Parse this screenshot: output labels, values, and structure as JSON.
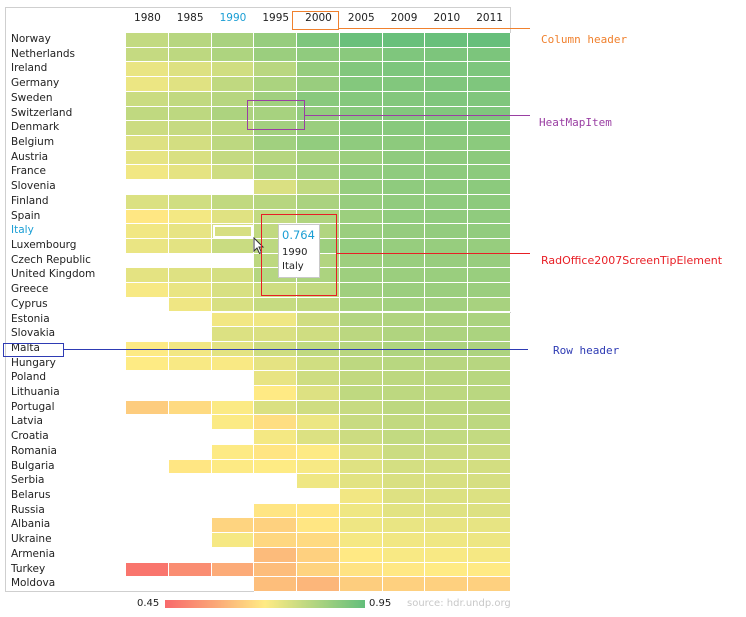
{
  "chart_data": {
    "type": "heatmap",
    "title": "",
    "columns": [
      "1980",
      "1985",
      "1990",
      "1995",
      "2000",
      "2005",
      "2009",
      "2010",
      "2011"
    ],
    "rows": [
      "Norway",
      "Netherlands",
      "Ireland",
      "Germany",
      "Sweden",
      "Switzerland",
      "Denmark",
      "Belgium",
      "Austria",
      "France",
      "Slovenia",
      "Finland",
      "Spain",
      "Italy",
      "Luxembourg",
      "Czech Republic",
      "United Kingdom",
      "Greece",
      "Cyprus",
      "Estonia",
      "Slovakia",
      "Malta",
      "Hungary",
      "Poland",
      "Lithuania",
      "Portugal",
      "Latvia",
      "Croatia",
      "Romania",
      "Bulgaria",
      "Serbia",
      "Belarus",
      "Russia",
      "Albania",
      "Ukraine",
      "Armenia",
      "Turkey",
      "Moldova"
    ],
    "values": [
      [
        0.796,
        0.816,
        0.838,
        0.866,
        0.906,
        0.938,
        0.941,
        0.941,
        0.943
      ],
      [
        0.793,
        0.806,
        0.83,
        0.861,
        0.878,
        0.888,
        0.905,
        0.909,
        0.91
      ],
      [
        0.735,
        0.754,
        0.775,
        0.812,
        0.869,
        0.901,
        0.908,
        0.908,
        0.908
      ],
      [
        0.73,
        0.749,
        0.801,
        0.834,
        0.864,
        0.897,
        0.9,
        0.903,
        0.905
      ],
      [
        0.785,
        0.799,
        0.816,
        0.851,
        0.889,
        0.895,
        0.898,
        0.904,
        0.904
      ],
      [
        0.801,
        0.806,
        0.831,
        0.841,
        0.873,
        0.893,
        0.899,
        0.901,
        0.903
      ],
      [
        0.781,
        0.792,
        0.806,
        0.848,
        0.862,
        0.888,
        0.891,
        0.895,
        0.895
      ],
      [
        0.753,
        0.771,
        0.805,
        0.851,
        0.874,
        0.88,
        0.883,
        0.884,
        0.886
      ],
      [
        0.74,
        0.761,
        0.794,
        0.817,
        0.839,
        0.858,
        0.879,
        0.881,
        0.885
      ],
      [
        0.722,
        0.742,
        0.779,
        0.825,
        0.846,
        0.872,
        0.879,
        0.882,
        0.884
      ],
      [
        null,
        null,
        null,
        0.76,
        0.801,
        0.868,
        0.879,
        0.88,
        0.884
      ],
      [
        0.757,
        0.775,
        0.799,
        0.816,
        0.837,
        0.866,
        0.876,
        0.879,
        0.882
      ],
      [
        0.693,
        0.719,
        0.749,
        0.796,
        0.826,
        0.858,
        0.874,
        0.876,
        0.878
      ],
      [
        0.723,
        0.739,
        0.764,
        0.799,
        0.825,
        0.861,
        0.87,
        0.873,
        0.874
      ],
      [
        0.733,
        0.745,
        0.786,
        0.808,
        0.857,
        0.871,
        0.867,
        0.867,
        0.867
      ],
      [
        null,
        null,
        null,
        0.806,
        0.821,
        0.856,
        0.863,
        0.865,
        0.865
      ],
      [
        0.744,
        0.753,
        0.768,
        0.819,
        0.833,
        0.855,
        0.86,
        0.862,
        0.863
      ],
      [
        0.713,
        0.735,
        0.762,
        0.779,
        0.798,
        0.853,
        0.861,
        0.861,
        0.861
      ],
      [
        null,
        0.726,
        0.763,
        0.791,
        0.8,
        0.835,
        0.847,
        0.848,
        0.84
      ],
      [
        null,
        null,
        0.721,
        0.725,
        0.776,
        0.821,
        0.827,
        0.832,
        0.835
      ],
      [
        null,
        null,
        0.756,
        0.759,
        0.777,
        0.809,
        0.826,
        0.831,
        0.834
      ],
      [
        0.704,
        0.721,
        0.745,
        0.779,
        0.801,
        0.814,
        0.829,
        0.831,
        0.832
      ],
      [
        0.702,
        0.711,
        0.71,
        0.742,
        0.775,
        0.805,
        0.813,
        0.814,
        0.816
      ],
      [
        null,
        null,
        null,
        0.737,
        0.778,
        0.798,
        0.806,
        0.81,
        0.813
      ],
      [
        null,
        null,
        null,
        0.699,
        0.755,
        0.802,
        0.806,
        0.805,
        0.81
      ],
      [
        0.64,
        0.667,
        0.706,
        0.759,
        0.777,
        0.789,
        0.805,
        0.805,
        0.809
      ],
      [
        null,
        null,
        0.706,
        0.675,
        0.73,
        0.788,
        0.798,
        0.8,
        0.805
      ],
      [
        null,
        null,
        null,
        0.717,
        0.756,
        0.782,
        0.797,
        0.797,
        0.796
      ],
      [
        null,
        null,
        0.703,
        0.688,
        0.704,
        0.756,
        0.783,
        0.781,
        0.781
      ],
      [
        null,
        0.69,
        0.704,
        0.702,
        0.713,
        0.752,
        0.769,
        0.769,
        0.771
      ],
      [
        null,
        null,
        null,
        null,
        0.725,
        0.747,
        0.761,
        0.762,
        0.766
      ],
      [
        null,
        null,
        null,
        null,
        null,
        0.721,
        0.753,
        0.756,
        0.756
      ],
      [
        null,
        null,
        null,
        0.688,
        0.691,
        0.725,
        0.747,
        0.751,
        0.755
      ],
      [
        null,
        null,
        0.656,
        0.65,
        0.691,
        0.727,
        0.736,
        0.737,
        0.739
      ],
      [
        null,
        null,
        0.714,
        0.662,
        0.668,
        0.716,
        0.723,
        0.725,
        0.729
      ],
      [
        null,
        null,
        null,
        0.607,
        0.648,
        0.697,
        0.711,
        0.711,
        0.716
      ],
      [
        0.474,
        0.52,
        0.576,
        0.612,
        0.653,
        0.685,
        0.695,
        0.7,
        0.699
      ],
      [
        null,
        null,
        null,
        0.614,
        0.598,
        0.643,
        0.649,
        0.649,
        0.649
      ]
    ],
    "color_scale": {
      "min": 0.45,
      "mid": 0.7,
      "max": 0.95,
      "min_color": "#F8696B",
      "mid_color": "#FFEB84",
      "max_color": "#63BE7B"
    },
    "legend": {
      "min_label": "0.45",
      "max_label": "0.95",
      "placement": "bottom"
    },
    "source": "source: hdr.undp.org",
    "hover": {
      "row": "Italy",
      "column": "1990",
      "value": "0.764"
    }
  },
  "tooltip": {
    "value": "0.764",
    "column": "1990",
    "row": "Italy"
  },
  "annotations": {
    "column_header": {
      "label": "Column header",
      "color": "#F0812E"
    },
    "heatmap_item": {
      "label": "HeatMapItem",
      "color": "#9A3FA3"
    },
    "screen_tip": {
      "label": "RadOffice2007ScreenTipElement",
      "color": "#E81E25"
    },
    "row_header": {
      "label": "Row header",
      "color": "#2E3BB4"
    }
  }
}
